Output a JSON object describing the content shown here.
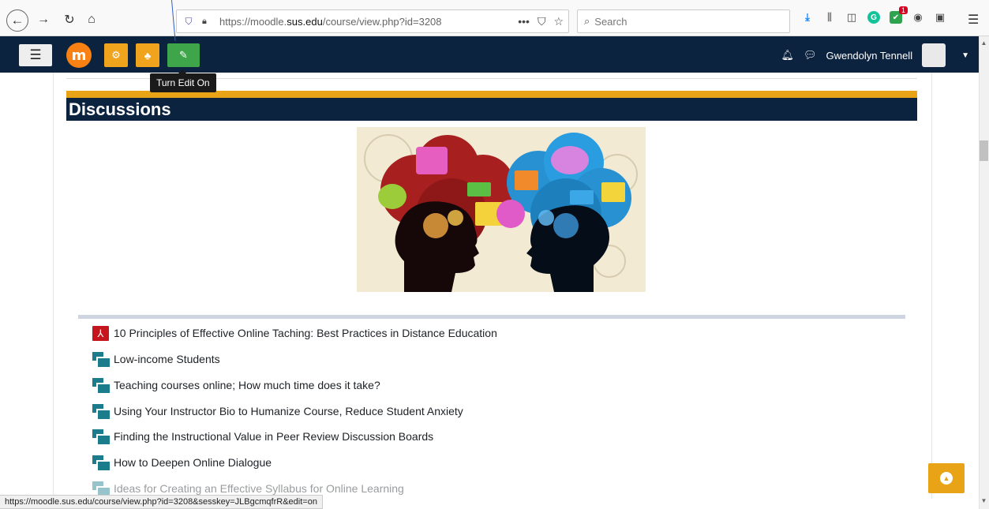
{
  "browser": {
    "url_prefix": "https://moodle.",
    "url_domain": "sus.edu",
    "url_path": "/course/view.php?id=3208",
    "search_placeholder": "Search",
    "notification_count": "1"
  },
  "navbar": {
    "user_name": "Gwendolyn Tennell",
    "logo_letter": "m"
  },
  "tooltip": {
    "text": "Turn Edit On"
  },
  "section": {
    "title": "Discussions"
  },
  "activities": [
    {
      "type": "pdf",
      "label": "10 Principles of Effective Online Taching: Best Practices in Distance Education"
    },
    {
      "type": "forum",
      "label": "Low-income Students"
    },
    {
      "type": "forum",
      "label": "Teaching courses online; How much time does it take?"
    },
    {
      "type": "forum",
      "label": "Using Your Instructor Bio to Humanize Course, Reduce Student Anxiety"
    },
    {
      "type": "forum",
      "label": "Finding the Instructional Value in Peer Review Discussion Boards"
    },
    {
      "type": "forum",
      "label": "How to Deepen Online Dialogue"
    },
    {
      "type": "forum",
      "label": "Ideas for Creating an Effective Syllabus for Online Learning"
    }
  ],
  "status_bar": {
    "link": "https://moodle.sus.edu/course/view.php?id=3208&sesskey=JLBgcmqfrR&edit=on"
  },
  "icons": {
    "back": "back-arrow-icon",
    "forward": "forward-arrow-icon",
    "reload": "reload-icon",
    "home": "home-icon",
    "menu": "hamburger-icon",
    "bell": "bell-icon",
    "chat": "chat-icon",
    "scroll_top": "chevron-up-icon"
  },
  "colors": {
    "navbar": "#0c2340",
    "gold": "#e8a317",
    "edit_green": "#3fa54a",
    "admin_orange": "#f0a31d",
    "forum_teal": "#1b7c8c",
    "pdf_red": "#c4161c"
  }
}
